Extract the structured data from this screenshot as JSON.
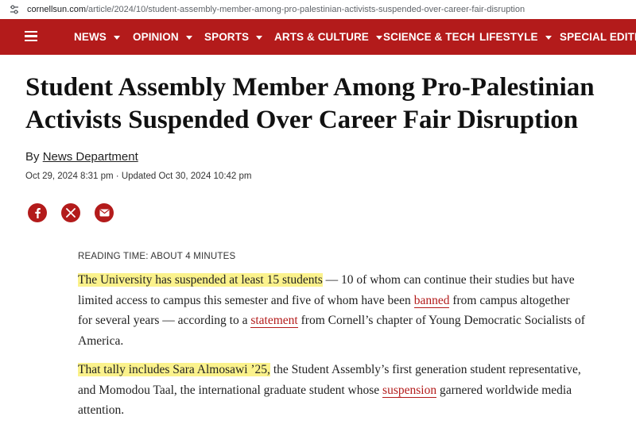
{
  "browser": {
    "url_host": "cornellsun.com",
    "url_path": "/article/2024/10/student-assembly-member-among-pro-palestinian-activists-suspended-over-career-fair-disruption"
  },
  "colors": {
    "brand_red": "#b31b1b",
    "highlight": "#fbf28c"
  },
  "nav": {
    "menu_icon": "hamburger-menu-icon",
    "items": [
      {
        "label": "NEWS",
        "dropdown": true
      },
      {
        "label": "OPINION",
        "dropdown": true
      },
      {
        "label": "SPORTS",
        "dropdown": true
      },
      {
        "label": "ARTS & CULTURE",
        "dropdown": true
      },
      {
        "label": "SCIENCE & TECH",
        "dropdown": false
      },
      {
        "label": "LIFESTYLE",
        "dropdown": true
      },
      {
        "label": "SPECIAL EDITION",
        "dropdown": false
      }
    ]
  },
  "article": {
    "headline": "Student Assembly Member Among Pro-Palestinian Activists Suspended Over Career Fair Disruption",
    "byline_prefix": "By",
    "author": "News Department",
    "dates": "Oct 29, 2024 8:31 pm · Updated Oct 30, 2024 10:42 pm",
    "share": [
      "facebook-icon",
      "x-icon",
      "email-icon"
    ],
    "reading_time": "READING TIME: ABOUT 4 MINUTES",
    "p1": {
      "highlight": "The University has suspended at least 15 students",
      "t1": " — 10 of whom can continue their studies but have limited access to campus this semester and five of whom have been ",
      "link1": "banned",
      "t2": " from campus altogether for several years — according to a ",
      "link2": "statement",
      "t3": " from Cornell’s chapter of Young Democratic Socialists of America."
    },
    "p2": {
      "highlight": "That tally includes Sara Almosawi ’25,",
      "t1": " the Student Assembly’s first generation student representative, and Momodou Taal, the international graduate student whose ",
      "link1": "suspension",
      "t2": " garnered worldwide media attention."
    }
  }
}
